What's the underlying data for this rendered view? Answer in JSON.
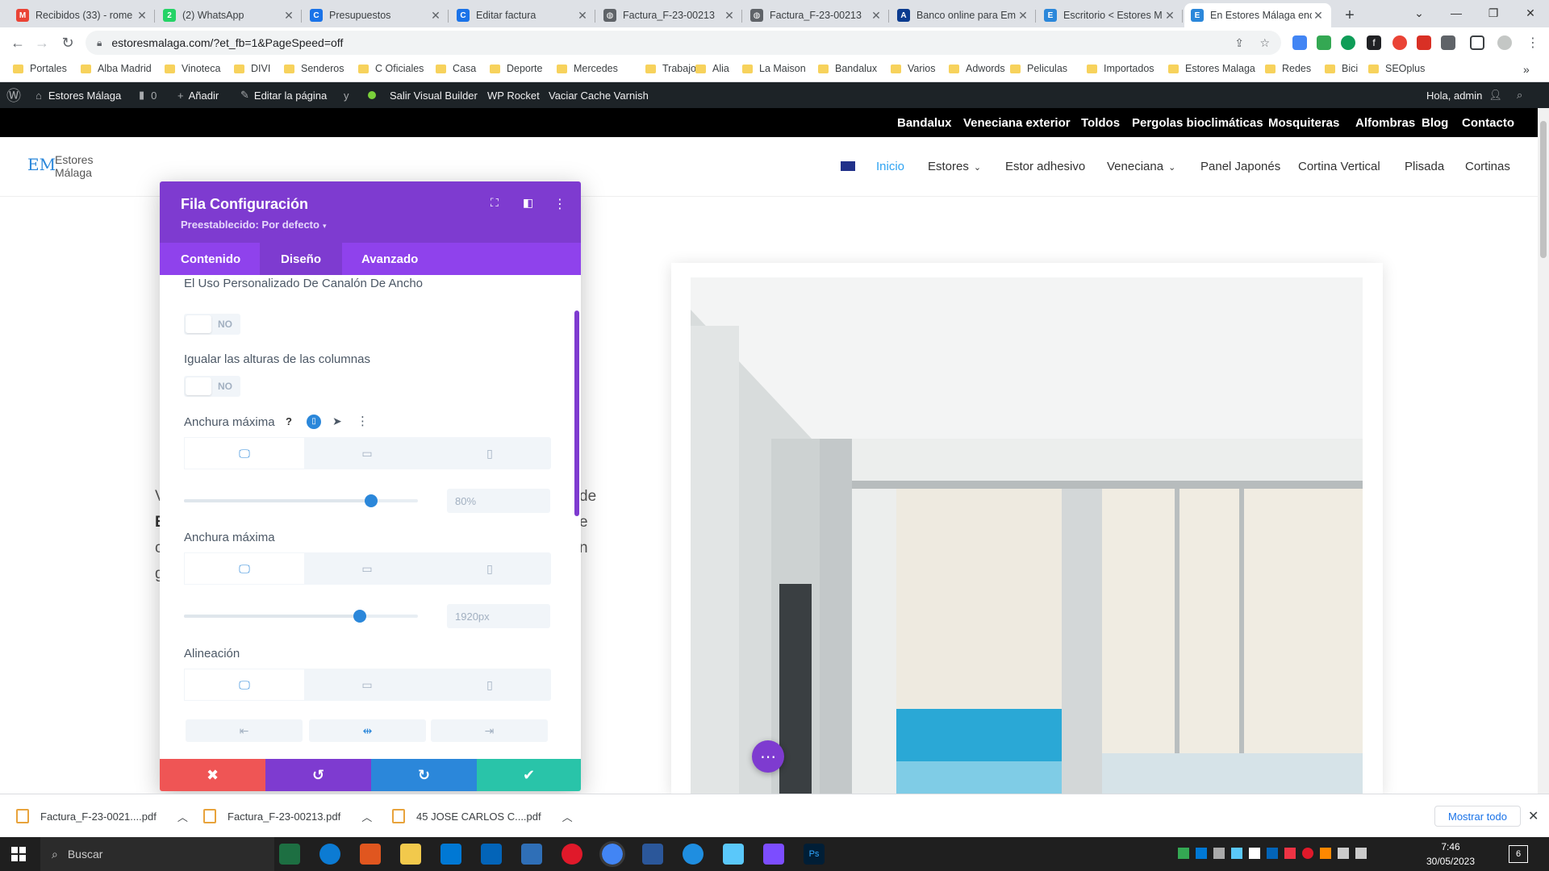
{
  "browser": {
    "tabs": [
      {
        "title": "Recibidos (33) - rome",
        "icon": "gmail-icon",
        "color": "#ea4335"
      },
      {
        "title": "(2) WhatsApp",
        "icon": "whatsapp-icon",
        "color": "#25d366"
      },
      {
        "title": "Presupuestos",
        "icon": "doc-icon",
        "color": "#1a73e8"
      },
      {
        "title": "Editar factura",
        "icon": "doc-icon",
        "color": "#1a73e8"
      },
      {
        "title": "Factura_F-23-00213",
        "icon": "globe-icon",
        "color": "#5f6368"
      },
      {
        "title": "Factura_F-23-00213",
        "icon": "globe-icon",
        "color": "#5f6368"
      },
      {
        "title": "Banco online para Em",
        "icon": "bank-icon",
        "color": "#0b3b8f"
      },
      {
        "title": "Escritorio < Estores M",
        "icon": "site-icon",
        "color": "#2b87da"
      },
      {
        "title": "En Estores Málaga enc",
        "icon": "site-icon",
        "color": "#2b87da"
      }
    ],
    "new_tab": "+",
    "url": "estoresmalaga.com/?et_fb=1&PageSpeed=off",
    "bookmarks": [
      "Portales",
      "Alba Madrid",
      "Vinoteca",
      "DIVI",
      "Senderos",
      "C Oficiales",
      "Casa",
      "Deporte",
      "Mercedes",
      "Trabajo",
      "Alia",
      "La Maison",
      "Bandalux",
      "Varios",
      "Adwords",
      "Peliculas",
      "Importados",
      "Estores Malaga",
      "Redes",
      "Bici",
      "SEOplus"
    ]
  },
  "wpbar": {
    "site": "Estores Málaga",
    "comments": "0",
    "add": "Añadir",
    "edit": "Editar la página",
    "exit_vb": "Salir Visual Builder",
    "rocket": "WP Rocket",
    "varnish": "Vaciar Cache Varnish",
    "greeting": "Hola, admin"
  },
  "site": {
    "topnav": [
      "Bandalux",
      "Veneciana exterior",
      "Toldos",
      "Pergolas bioclimáticas",
      "Mosquiteras",
      "Alfombras",
      "Blog",
      "Contacto"
    ],
    "logo_line1": "Estores",
    "logo_line2": "Málaga",
    "logo_mark": "EM",
    "menu": [
      {
        "label": "Inicio",
        "dropdown": false,
        "active": true
      },
      {
        "label": "Estores",
        "dropdown": true,
        "active": false
      },
      {
        "label": "Estor adhesivo",
        "dropdown": false,
        "active": false
      },
      {
        "label": "Veneciana",
        "dropdown": true,
        "active": false
      },
      {
        "label": "Panel Japonés",
        "dropdown": false,
        "active": false
      },
      {
        "label": "Cortina Vertical",
        "dropdown": false,
        "active": false
      },
      {
        "label": "Plisada",
        "dropdown": false,
        "active": false
      },
      {
        "label": "Cortinas",
        "dropdown": false,
        "active": false
      }
    ]
  },
  "modal": {
    "title": "Fila Configuración",
    "preset": "Preestablecido: Por defecto",
    "tabs": [
      "Contenido",
      "Diseño",
      "Avanzado"
    ],
    "active_tab": "Diseño",
    "field_gutter": "El Uso Personalizado De Canalón De Ancho",
    "gutter_toggle": "NO",
    "field_equal": "Igualar las alturas de las columnas",
    "equal_toggle": "NO",
    "field_width": "Anchura máxima",
    "width_value": "80%",
    "width_fraction": 0.8,
    "field_maxwidth": "Anchura máxima",
    "maxwidth_value": "1920px",
    "maxwidth_fraction": 0.75,
    "field_align": "Alineación",
    "help_glyph": "?"
  },
  "downloads": {
    "items": [
      "Factura_F-23-0021....pdf",
      "Factura_F-23-00213.pdf",
      "45 JOSE CARLOS C....pdf"
    ],
    "show_all": "Mostrar todo"
  },
  "taskbar": {
    "search": "Buscar",
    "time": "7:46",
    "date": "30/05/2023",
    "notif_count": "6"
  },
  "colors": {
    "divi_purple": "#7e3bd0",
    "divi_blue": "#2b87da",
    "cancel": "#ef5555",
    "undo": "#7e3bd0",
    "redo": "#2b87da",
    "save": "#29c4a9",
    "active_menu": "#2ea3f2"
  }
}
